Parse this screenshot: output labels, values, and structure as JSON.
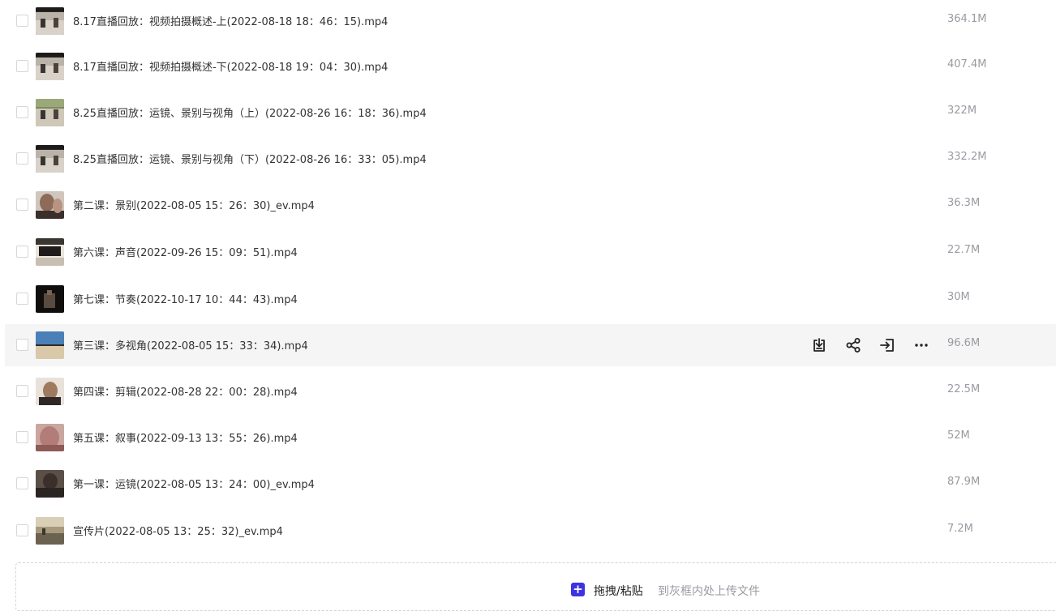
{
  "files": [
    {
      "name": "8.17直播回放：视频拍摄概述-上(2022-08-18 18：46：15).mp4",
      "size": "364.1M",
      "thumb": "stage"
    },
    {
      "name": "8.17直播回放：视频拍摄概述-下(2022-08-18 19：04：30).mp4",
      "size": "407.4M",
      "thumb": "stage"
    },
    {
      "name": "8.25直播回放：运镜、景别与视角（上）(2022-08-26 16：18：36).mp4",
      "size": "322M",
      "thumb": "stage-green"
    },
    {
      "name": "8.25直播回放：运镜、景别与视角（下）(2022-08-26 16：33：05).mp4",
      "size": "332.2M",
      "thumb": "stage"
    },
    {
      "name": "第二课：景别(2022-08-05 15：26：30)_ev.mp4",
      "size": "36.3M",
      "thumb": "portrait"
    },
    {
      "name": "第六课：声音(2022-09-26 15：09：51).mp4",
      "size": "22.7M",
      "thumb": "piano"
    },
    {
      "name": "第七课：节奏(2022-10-17 10：44：43).mp4",
      "size": "30M",
      "thumb": "dark"
    },
    {
      "name": "第三课：多视角(2022-08-05 15：33：34).mp4",
      "size": "96.6M",
      "thumb": "blue-room"
    },
    {
      "name": "第四课：剪辑(2022-08-28 22：00：28).mp4",
      "size": "22.5M",
      "thumb": "portrait-light"
    },
    {
      "name": "第五课：叙事(2022-09-13 13：55：26).mp4",
      "size": "52M",
      "thumb": "pink"
    },
    {
      "name": "第一课：运镜(2022-08-05 13：24：00)_ev.mp4",
      "size": "87.9M",
      "thumb": "portrait-dark"
    },
    {
      "name": "宣传片(2022-08-05 13：25：32)_ev.mp4",
      "size": "7.2M",
      "thumb": "landscape"
    }
  ],
  "hover_row_index": 7,
  "row_actions": [
    {
      "name": "download-icon"
    },
    {
      "name": "share-icon"
    },
    {
      "name": "move-icon"
    },
    {
      "name": "more-icon"
    }
  ],
  "upload": {
    "main_label": "拖拽/粘贴",
    "hint_label": "到灰框内处上传文件",
    "accent_color": "#3d34e0"
  }
}
